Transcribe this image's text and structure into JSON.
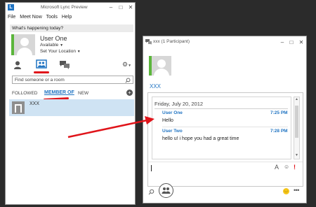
{
  "main_window": {
    "title": "Microsoft Lync Preview",
    "menu": [
      "File",
      "Meet Now",
      "Tools",
      "Help"
    ],
    "whats_happening": "What's happening today?",
    "user": {
      "name": "User One",
      "status": "Available",
      "location": "Set Your Location"
    },
    "search_placeholder": "Find someone or a room",
    "tabs": [
      "FOLLOWED",
      "MEMBER OF",
      "NEW"
    ],
    "group": {
      "name": "XXX"
    }
  },
  "conv_window": {
    "title": "xxx (1 Participant)",
    "participant": "XXX",
    "date_header": "Friday, July 20, 2012",
    "messages": [
      {
        "sender": "User One",
        "time": "7:25 PM",
        "text": "Hello"
      },
      {
        "sender": "User Two",
        "time": "7:28 PM",
        "text": "hello u! i hope you had a great time"
      }
    ]
  },
  "colors": {
    "accent": "#1f73c2",
    "presence_green": "#5bb53b",
    "annotation_red": "#e0141a",
    "selected_row": "#cfe3f3"
  }
}
